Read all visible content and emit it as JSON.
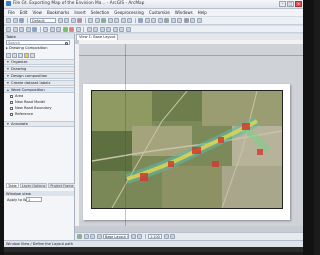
{
  "window": {
    "title": "File Gt. Exporting Map of the Envision Ma... - ArcGIS - ArcMap",
    "controls": [
      "–",
      "□",
      "×"
    ]
  },
  "menu": [
    "File",
    "Edit",
    "View",
    "Bookmarks",
    "Insert",
    "Selection",
    "Geoprocessing",
    "Customize",
    "Windows",
    "Help"
  ],
  "toolbar": {
    "layer_dropdown": "Default"
  },
  "left_panel": {
    "header": "Table",
    "search_placeholder": "Search",
    "tree_root": "Drawing Composition",
    "groups": [
      {
        "label": "Organize",
        "state": "collapsed"
      },
      {
        "label": "Drawing",
        "state": "collapsed"
      },
      {
        "label": "Design composition",
        "state": "collapsed"
      },
      {
        "label": "Create dataset labels",
        "state": "collapsed"
      },
      {
        "label": "Word Composition",
        "state": "expanded"
      },
      {
        "label": "Annotate",
        "state": "collapsed"
      }
    ],
    "layers": [
      "Area",
      "New Road Model",
      "New Road Boundary",
      "Reference"
    ],
    "tabs": [
      "Table",
      "Layer Options",
      "Project Frame"
    ],
    "sub_panel_header": "Window view",
    "apply_label": "Apply to Window",
    "apply_value": "1"
  },
  "document": {
    "tab_label": "View 1: Base Layout"
  },
  "bottom_bar": {
    "layout_select": "Base Layout View",
    "scale_select": "1:100"
  },
  "status": {
    "text": "Window View / Define the Layout path"
  },
  "icons": {
    "app": "app-icon",
    "search": "search-icon"
  },
  "colors": {
    "titlebar": "#e9edf3",
    "accent": "#3c78c8",
    "close": "#d9534f"
  }
}
